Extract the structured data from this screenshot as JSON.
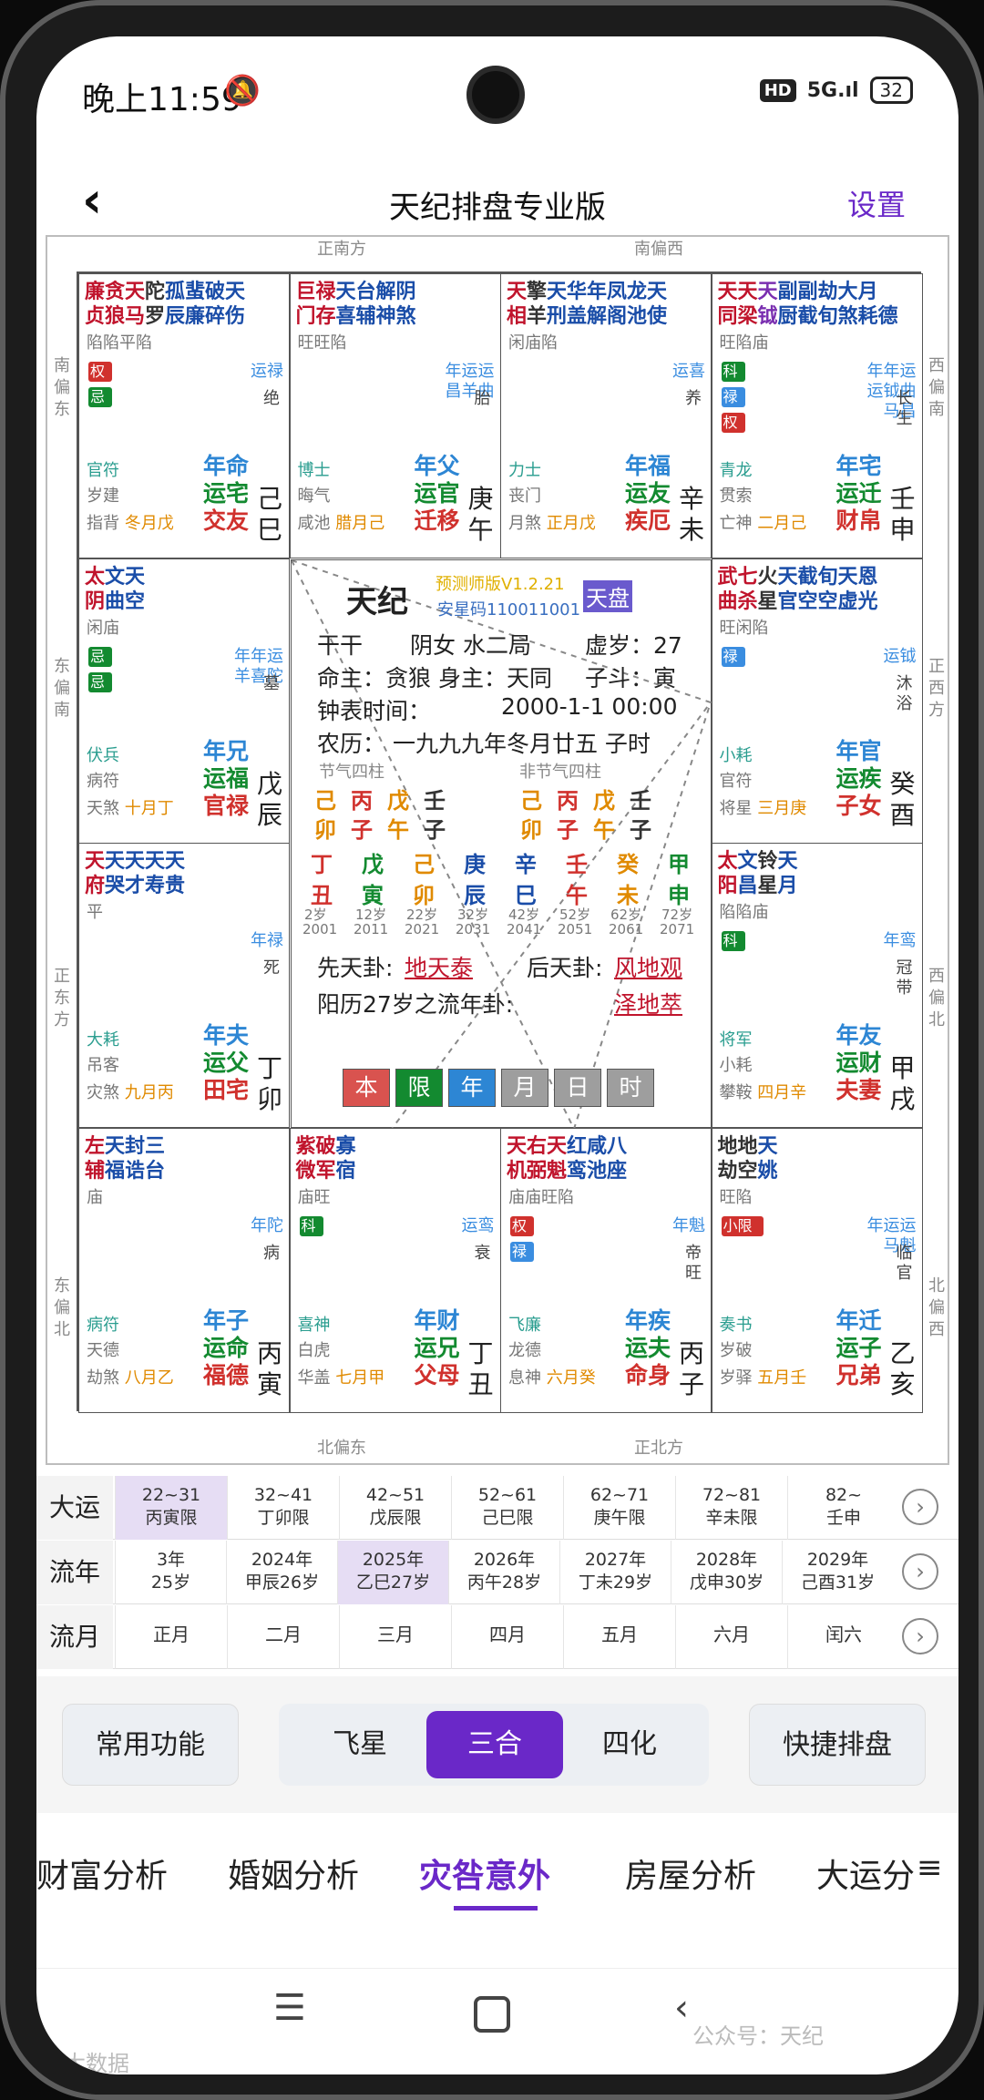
{
  "status": {
    "time": "晚上11:59",
    "bell": "🔕",
    "hd": "HD",
    "signal": "5G.ıl",
    "battery": "32"
  },
  "nav": {
    "back": "‹",
    "title": "天纪排盘专业版",
    "settings": "设置"
  },
  "dirs": {
    "s": "正南方",
    "ssw": "南偏西",
    "sse": "南偏东",
    "wsw": "西偏南",
    "ese": "东偏南",
    "w": "正西方",
    "e": "正东方",
    "wnw": "西偏北",
    "ene": "东偏北",
    "nnw": "北偏西",
    "nne": "北偏东",
    "n": "正北方"
  },
  "palaces": [
    {
      "stars": [
        [
          "廉",
          "贞"
        ],
        [
          "贪",
          "狼"
        ],
        [
          "天",
          "马"
        ],
        [
          "陀",
          "罗"
        ],
        [
          "孤",
          "辰"
        ],
        [
          "蜚",
          "廉"
        ],
        [
          "破",
          "碎"
        ],
        [
          "天",
          "伤"
        ]
      ],
      "colors": [
        "#c0142c",
        "#c0142c",
        "#c0142c",
        "#333",
        "#1a4da8",
        "#1a4da8",
        "#1a4da8",
        "#1a4da8"
      ],
      "brt": "陷陷平陷",
      "badges": [
        "权",
        "忌"
      ],
      "yun": "运禄",
      "boshi": "官符",
      "sui": "岁建",
      "jiang": "指背",
      "liu": "冬月戊",
      "l1": "年命",
      "l2": "运宅",
      "l3": "交友",
      "gz": "己巳",
      "cs": "绝"
    },
    {
      "stars": [
        [
          "巨",
          "门"
        ],
        [
          "禄",
          "存"
        ],
        [
          "天",
          "喜"
        ],
        [
          "台",
          "辅"
        ],
        [
          "解",
          "神"
        ],
        [
          "阴",
          "煞"
        ]
      ],
      "colors": [
        "#c0142c",
        "#c0142c",
        "#1a4da8",
        "#1a4da8",
        "#1a4da8",
        "#1a4da8"
      ],
      "brt": "旺旺陷",
      "badges": [],
      "yun": "年运运昌羊曲",
      "boshi": "博士",
      "sui": "晦气",
      "jiang": "咸池",
      "liu": "腊月己",
      "l1": "年父",
      "l2": "运官",
      "l3": "迁移",
      "gz": "庚午",
      "cs": "胎"
    },
    {
      "stars": [
        [
          "天",
          "相"
        ],
        [
          "擎",
          "羊"
        ],
        [
          "天",
          "刑"
        ],
        [
          "华",
          "盖"
        ],
        [
          "年",
          "解"
        ],
        [
          "凤",
          "阁"
        ],
        [
          "龙",
          "池"
        ],
        [
          "天",
          "使"
        ]
      ],
      "colors": [
        "#c0142c",
        "#333",
        "#1a4da8",
        "#1a4da8",
        "#1a4da8",
        "#1a4da8",
        "#1a4da8",
        "#1a4da8"
      ],
      "brt": "闲庙陷",
      "badges": [],
      "yun": "运喜",
      "boshi": "力士",
      "sui": "丧门",
      "jiang": "月煞",
      "liu": "正月戊",
      "l1": "年福",
      "l2": "运友",
      "l3": "疾厄",
      "gz": "辛未",
      "cs": "养"
    },
    {
      "stars": [
        [
          "天",
          "同"
        ],
        [
          "天",
          "梁"
        ],
        [
          "天",
          "钺"
        ],
        [
          "副",
          "厨"
        ],
        [
          "副",
          "截"
        ],
        [
          "劫",
          "旬"
        ],
        [
          "大",
          "煞"
        ],
        [
          "月",
          "耗"
        ],
        [
          "",
          "德"
        ]
      ],
      "colors": [
        "#c0142c",
        "#c0142c",
        "#7a2fb0",
        "#1a4da8",
        "#1a4da8",
        "#1a4da8",
        "#1a4da8",
        "#1a4da8",
        "#1a4da8"
      ],
      "brt": "旺陷庙",
      "badges": [
        "科",
        "禄",
        "权"
      ],
      "yun": "年年运运钺曲马昌",
      "boshi": "青龙",
      "sui": "贯索",
      "jiang": "亡神",
      "liu": "二月己",
      "l1": "年宅",
      "l2": "运迁",
      "l3": "财帛",
      "gz": "壬申",
      "cs": "长生"
    },
    {
      "stars": [
        [
          "太",
          "阴"
        ],
        [
          "文",
          "曲"
        ],
        [
          "天",
          "空"
        ]
      ],
      "colors": [
        "#c0142c",
        "#1a4da8",
        "#1a4da8"
      ],
      "brt": "闲庙",
      "badges": [
        "忌",
        "忌"
      ],
      "yun": "年年运羊喜陀",
      "boshi": "伏兵",
      "sui": "病符",
      "jiang": "天煞",
      "liu": "十月丁",
      "l1": "年兄",
      "l2": "运福",
      "l3": "官禄",
      "gz": "戊辰",
      "cs": "墓"
    },
    {
      "stars": [
        [
          "武",
          "曲"
        ],
        [
          "七",
          "杀"
        ],
        [
          "火",
          "星"
        ],
        [
          "天",
          "官"
        ],
        [
          "截",
          "空"
        ],
        [
          "旬",
          "空"
        ],
        [
          "天",
          "虚"
        ],
        [
          "恩",
          "光"
        ]
      ],
      "colors": [
        "#c0142c",
        "#c0142c",
        "#333",
        "#1a4da8",
        "#1a4da8",
        "#1a4da8",
        "#1a4da8",
        "#1a4da8"
      ],
      "brt": "旺闲陷",
      "badges": [
        "禄"
      ],
      "yun": "运钺",
      "boshi": "小耗",
      "sui": "官符",
      "jiang": "将星",
      "liu": "三月庚",
      "l1": "年官",
      "l2": "运疾",
      "l3": "子女",
      "gz": "癸酉",
      "cs": "沐浴"
    },
    {
      "stars": [
        [
          "天",
          "府"
        ],
        [
          "天",
          "哭"
        ],
        [
          "天",
          "才"
        ],
        [
          "天",
          "寿"
        ],
        [
          "天",
          "贵"
        ]
      ],
      "colors": [
        "#c0142c",
        "#1a4da8",
        "#1a4da8",
        "#1a4da8",
        "#1a4da8"
      ],
      "brt": "平",
      "badges": [],
      "yun": "年禄",
      "boshi": "大耗",
      "sui": "吊客",
      "jiang": "灾煞",
      "liu": "九月丙",
      "l1": "年夫",
      "l2": "运父",
      "l3": "田宅",
      "gz": "丁卯",
      "cs": "死"
    },
    {
      "stars": [
        [
          "太",
          "阳"
        ],
        [
          "文",
          "昌"
        ],
        [
          "铃",
          "星"
        ],
        [
          "天",
          "月"
        ]
      ],
      "colors": [
        "#c0142c",
        "#1a4da8",
        "#333",
        "#1a4da8"
      ],
      "brt": "陷陷庙",
      "badges": [
        "科"
      ],
      "yun": "年鸾",
      "boshi": "将军",
      "sui": "小耗",
      "jiang": "攀鞍",
      "liu": "四月辛",
      "l1": "年友",
      "l2": "运财",
      "l3": "夫妻",
      "gz": "甲戌",
      "cs": "冠带"
    },
    {
      "stars": [
        [
          "左",
          "辅"
        ],
        [
          "天",
          "福"
        ],
        [
          "封",
          "诰"
        ],
        [
          "三",
          "台"
        ]
      ],
      "colors": [
        "#c0142c",
        "#1a4da8",
        "#1a4da8",
        "#1a4da8"
      ],
      "brt": "庙",
      "badges": [],
      "yun": "年陀",
      "boshi": "病符",
      "sui": "天德",
      "jiang": "劫煞",
      "liu": "八月乙",
      "l1": "年子",
      "l2": "运命",
      "l3": "福德",
      "gz": "丙寅",
      "cs": "病"
    },
    {
      "stars": [
        [
          "紫",
          "微"
        ],
        [
          "破",
          "军"
        ],
        [
          "寡",
          "宿"
        ]
      ],
      "colors": [
        "#c0142c",
        "#c0142c",
        "#1a4da8"
      ],
      "brt": "庙旺",
      "badges": [
        "科"
      ],
      "yun": "运鸾",
      "boshi": "喜神",
      "sui": "白虎",
      "jiang": "华盖",
      "liu": "七月甲",
      "l1": "年财",
      "l2": "运兄",
      "l3": "父母",
      "gz": "丁丑",
      "cs": "衰"
    },
    {
      "stars": [
        [
          "天",
          "机"
        ],
        [
          "右",
          "弼"
        ],
        [
          "天",
          "魁"
        ],
        [
          "红",
          "鸾"
        ],
        [
          "咸",
          "池"
        ],
        [
          "八",
          "座"
        ]
      ],
      "colors": [
        "#c0142c",
        "#c0142c",
        "#c0142c",
        "#1a4da8",
        "#1a4da8",
        "#1a4da8"
      ],
      "brt": "庙庙旺陷",
      "badges": [
        "权",
        "禄"
      ],
      "yun": "年魁",
      "boshi": "飞廉",
      "sui": "龙德",
      "jiang": "息神",
      "liu": "六月癸",
      "l1": "年疾",
      "l2": "运夫",
      "l3": "命身",
      "gz": "丙子",
      "cs": "帝旺"
    },
    {
      "stars": [
        [
          "地",
          "劫"
        ],
        [
          "地",
          "空"
        ],
        [
          "天",
          "姚"
        ]
      ],
      "colors": [
        "#333",
        "#333",
        "#1a4da8"
      ],
      "brt": "旺陷",
      "badges": [
        "小限"
      ],
      "yun": "年运运马魁",
      "boshi": "奏书",
      "sui": "岁破",
      "jiang": "岁驿",
      "liu": "五月壬",
      "l1": "年迁",
      "l2": "运子",
      "l3": "兄弟",
      "gz": "乙亥",
      "cs": "临官"
    }
  ],
  "center": {
    "brand": "天纪",
    "version": "预测师版V1.2.21",
    "code": "安星码110011001",
    "tianpan": "天盘",
    "l1a": "干干",
    "l1b": "阴女 水二局",
    "l1c": "虚岁：27",
    "l2a": "命主：贪狼  身主：天同",
    "l2b": "子斗：寅",
    "l3a": "钟表时间：",
    "l3b": "2000-1-1 00:00",
    "l4": "农历：  一九九九年冬月廿五 子时",
    "jq": "节气四柱",
    "fjq": "非节气四柱",
    "p1": [
      "己",
      "丙",
      "戊",
      "壬"
    ],
    "p2": [
      "卯",
      "子",
      "午",
      "子"
    ],
    "p3": [
      "己",
      "丙",
      "戊",
      "壬"
    ],
    "p4": [
      "卯",
      "子",
      "午",
      "子"
    ],
    "dy_tg": [
      "丁",
      "戊",
      "己",
      "庚",
      "辛",
      "壬",
      "癸",
      "甲"
    ],
    "dy_dz": [
      "丑",
      "寅",
      "卯",
      "辰",
      "巳",
      "午",
      "未",
      "申"
    ],
    "dy_age": [
      "2岁",
      "12岁",
      "22岁",
      "32岁",
      "42岁",
      "52岁",
      "62岁",
      "72岁"
    ],
    "dy_year": [
      "2001",
      "2011",
      "2021",
      "2031",
      "2041",
      "2051",
      "2061",
      "2071"
    ],
    "xtg_lbl": "先天卦:",
    "xtg": "地天泰",
    "htg_lbl": "后天卦:",
    "htg": "风地观",
    "ln_lbl": "阳历27岁之流年卦:",
    "ln": "泽地萃",
    "modes": [
      "本",
      "限",
      "年",
      "月",
      "日",
      "时"
    ]
  },
  "dayun": {
    "label": "大运",
    "cells": [
      [
        "22~31",
        "丙寅限"
      ],
      [
        "32~41",
        "丁卯限"
      ],
      [
        "42~51",
        "戊辰限"
      ],
      [
        "52~61",
        "己巳限"
      ],
      [
        "62~71",
        "庚午限"
      ],
      [
        "72~81",
        "辛未限"
      ],
      [
        "82~",
        "壬申"
      ]
    ]
  },
  "liunian": {
    "label": "流年",
    "cells": [
      [
        "3年",
        "25岁"
      ],
      [
        "2024年",
        "甲辰26岁"
      ],
      [
        "2025年",
        "乙巳27岁"
      ],
      [
        "2026年",
        "丙午28岁"
      ],
      [
        "2027年",
        "丁未29岁"
      ],
      [
        "2028年",
        "戊申30岁"
      ],
      [
        "2029年",
        "己酉31岁"
      ]
    ]
  },
  "liuyue": {
    "label": "流月",
    "cells": [
      "正月",
      "二月",
      "三月",
      "四月",
      "五月",
      "六月",
      "闰六"
    ]
  },
  "buttons": {
    "common": "常用功能",
    "feixing": "飞星",
    "sanhe": "三合",
    "sihua": "四化",
    "quick": "快捷排盘"
  },
  "tabs": [
    "财富分析",
    "婚姻分析",
    "灾咎意外",
    "房屋分析",
    "大运分"
  ],
  "menu": "≡",
  "watermark": {
    "l": "大数据",
    "r": "公众号：天纪"
  },
  "accent": "#6a28c8"
}
